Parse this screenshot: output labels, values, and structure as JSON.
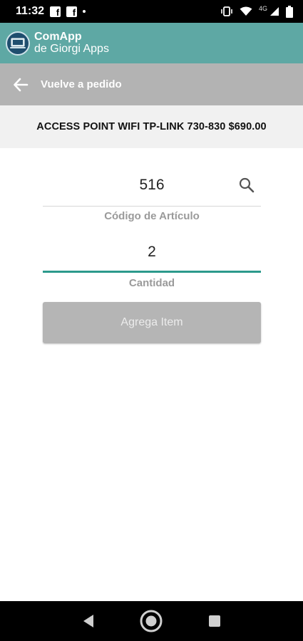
{
  "status_bar": {
    "time": "11:32",
    "notif_icons": [
      "facebook-icon",
      "facebook-icon"
    ],
    "network_label": "4G"
  },
  "app_header": {
    "name": "ComApp",
    "subtitle": "de Giorgi Apps",
    "bg_color": "#5ea8a4"
  },
  "toolbar": {
    "title": "Vuelve a pedido"
  },
  "product": {
    "text": "ACCESS POINT WIFI TP-LINK 730-830 $690.00"
  },
  "form": {
    "code_value": "516",
    "code_label": "Código de Artículo",
    "quantity_value": "2",
    "quantity_label": "Cantidad",
    "add_button_label": "Agrega Item",
    "accent_color": "#2c9a8c"
  },
  "nav_bar": {
    "buttons": [
      "back-icon",
      "home-icon",
      "recents-icon"
    ]
  }
}
